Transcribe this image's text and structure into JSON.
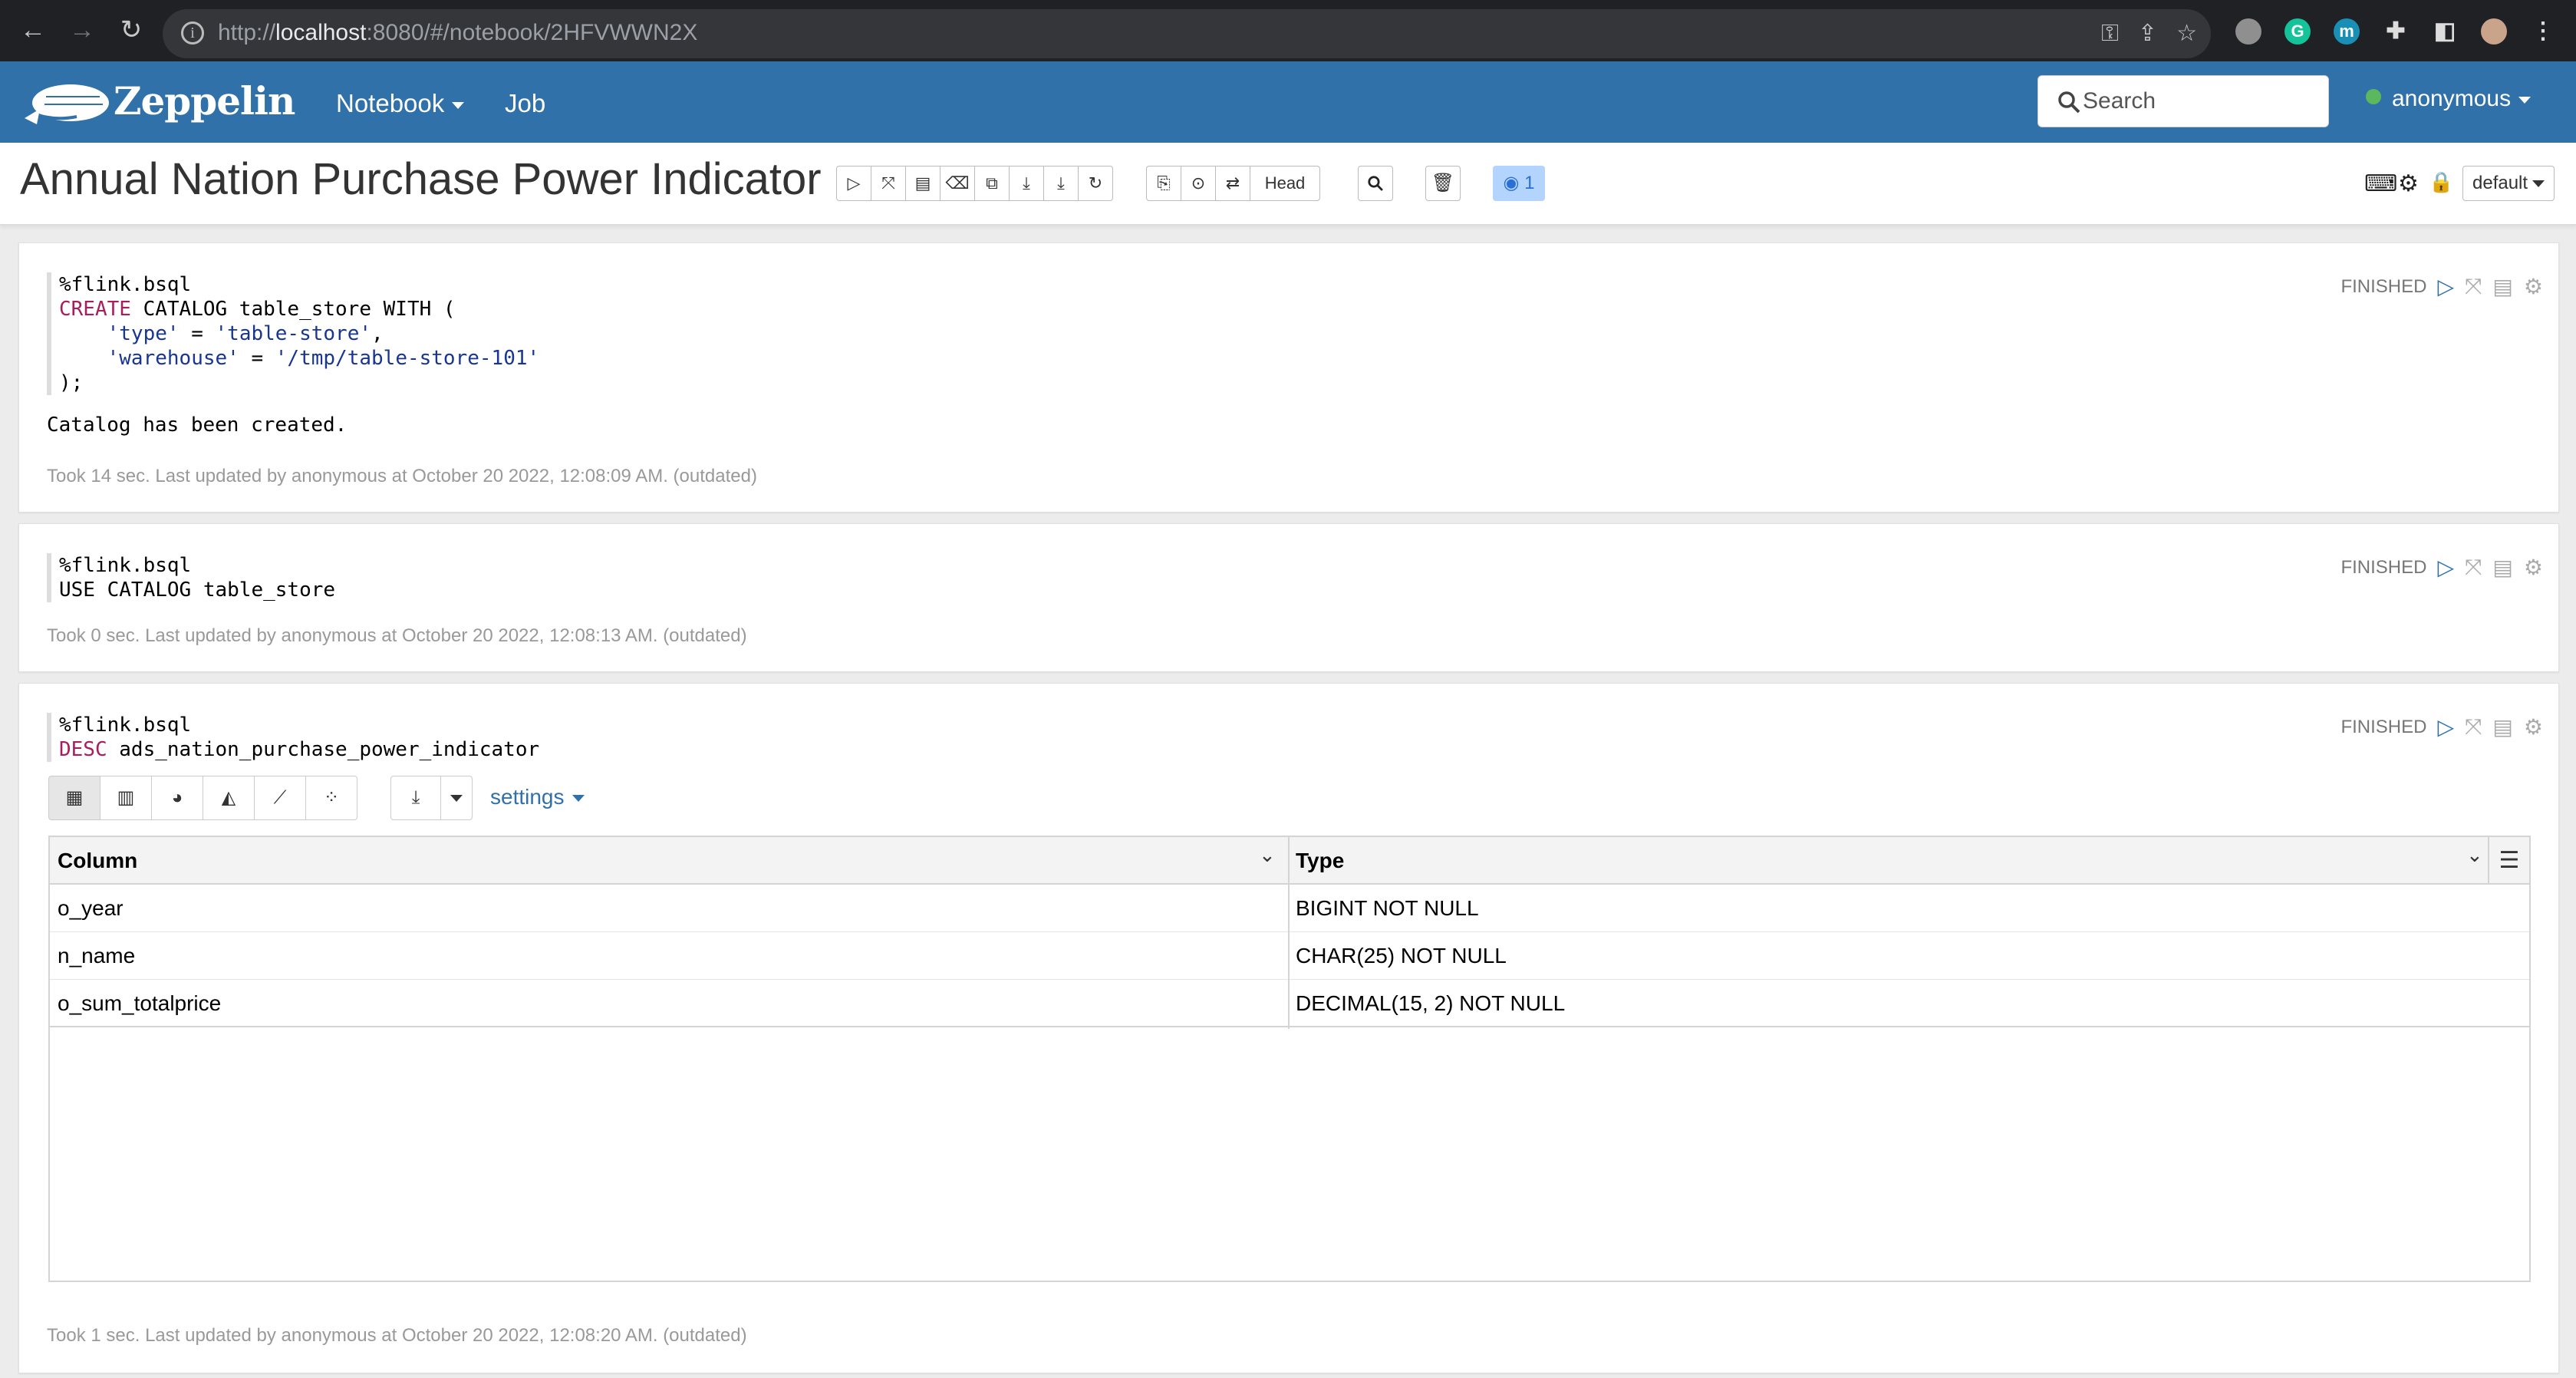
{
  "browser": {
    "url_prefix": "http://",
    "url_host": "localhost",
    "url_rest": ":8080/#/notebook/2HFVWWN2X"
  },
  "navbar": {
    "brand": "Zeppelin",
    "notebook_label": "Notebook",
    "job_label": "Job",
    "search_placeholder": "Search",
    "user": "anonymous"
  },
  "notebook": {
    "title": "Annual Nation Purchase Power Indicator",
    "head_label": "Head",
    "viewers_count": "1",
    "interpreter_default": "default"
  },
  "paragraphs": [
    {
      "code": [
        "%flink.bsql",
        "CREATE CATALOG table_store WITH (",
        "    'type' = 'table-store',",
        "    'warehouse' = '/tmp/table-store-101'",
        ");"
      ],
      "status": "FINISHED",
      "output": "Catalog has been created.",
      "footer": "Took 14 sec. Last updated by anonymous at October 20 2022, 12:08:09 AM. (outdated)"
    },
    {
      "code": [
        "%flink.bsql",
        "USE CATALOG table_store"
      ],
      "status": "FINISHED",
      "footer": "Took 0 sec. Last updated by anonymous at October 20 2022, 12:08:13 AM. (outdated)"
    },
    {
      "code": [
        "%flink.bsql",
        "DESC ads_nation_purchase_power_indicator"
      ],
      "status": "FINISHED",
      "settings_label": "settings",
      "table": {
        "columns": [
          "Column",
          "Type"
        ],
        "rows": [
          [
            "o_year",
            "BIGINT NOT NULL"
          ],
          [
            "n_name",
            "CHAR(25) NOT NULL"
          ],
          [
            "o_sum_totalprice",
            "DECIMAL(15, 2) NOT NULL"
          ]
        ]
      },
      "footer": "Took 1 sec. Last updated by anonymous at October 20 2022, 12:08:20 AM. (outdated)"
    }
  ]
}
